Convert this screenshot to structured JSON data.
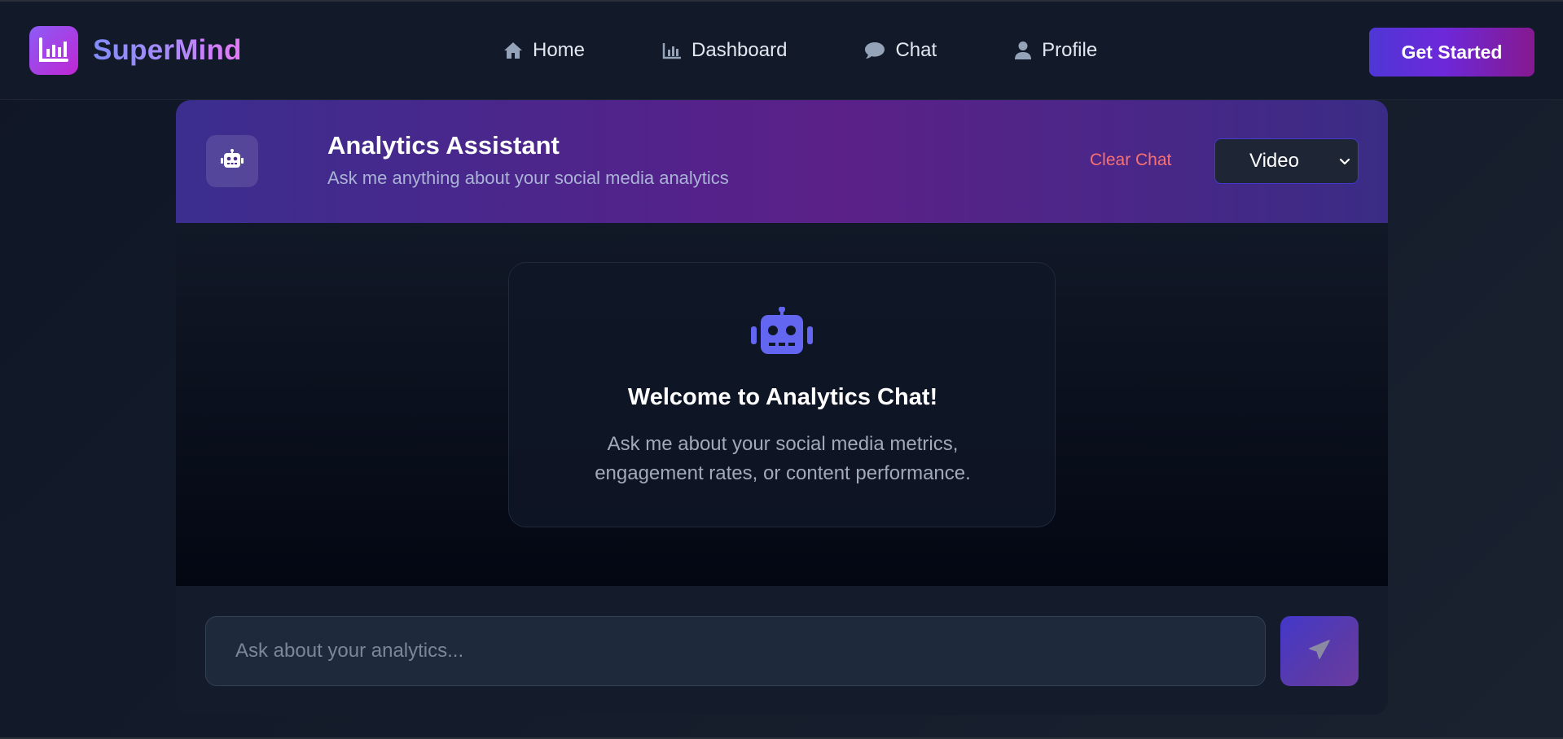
{
  "brand": {
    "name": "SuperMind",
    "logo_icon": "bar-chart-icon"
  },
  "nav": {
    "items": [
      {
        "label": "Home",
        "icon": "home-icon"
      },
      {
        "label": "Dashboard",
        "icon": "bar-chart-icon"
      },
      {
        "label": "Chat",
        "icon": "chat-bubble-icon"
      },
      {
        "label": "Profile",
        "icon": "user-icon"
      }
    ],
    "cta_label": "Get Started"
  },
  "chat": {
    "header": {
      "title": "Analytics Assistant",
      "subtitle": "Ask me anything about your social media analytics",
      "icon": "robot-icon",
      "clear_label": "Clear Chat",
      "mode": {
        "selected": "Video"
      }
    },
    "welcome": {
      "icon": "robot-icon",
      "title": "Welcome to Analytics Chat!",
      "text": "Ask me about your social media metrics, engagement rates, or content performance."
    },
    "input": {
      "placeholder": "Ask about your analytics...",
      "value": "",
      "send_icon": "paper-plane-icon"
    }
  },
  "colors": {
    "accent": "#6366f1",
    "brand_gradient_start": "#8b5cf6",
    "brand_gradient_end": "#c026d3",
    "danger": "#f87171",
    "background": "#0f1626"
  }
}
